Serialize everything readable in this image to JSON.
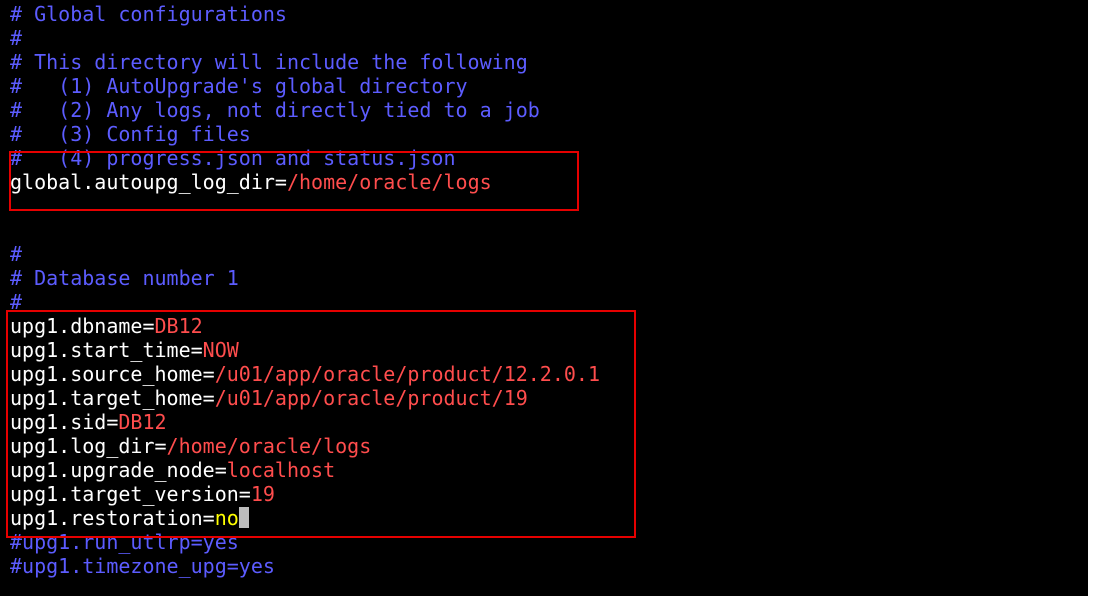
{
  "editor": {
    "comments_top": [
      "# Global configurations",
      "#",
      "# This directory will include the following",
      "#   (1) AutoUpgrade's global directory",
      "#   (2) Any logs, not directly tied to a job",
      "#   (3) Config files",
      "#   (4) progress.json and status.json"
    ],
    "global_log_dir": {
      "key": "global.autoupg_log_dir=",
      "value": "/home/oracle/logs"
    },
    "blank_1": "",
    "blank_2": "",
    "comments_db": [
      "#",
      "# Database number 1",
      "#"
    ],
    "db_params": [
      {
        "key": "upg1.dbname=",
        "value": "DB12"
      },
      {
        "key": "upg1.start_time=",
        "value": "NOW"
      },
      {
        "key": "upg1.source_home=",
        "value": "/u01/app/oracle/product/12.2.0.1"
      },
      {
        "key": "upg1.target_home=",
        "value": "/u01/app/oracle/product/19"
      },
      {
        "key": "upg1.sid=",
        "value": "DB12"
      },
      {
        "key": "upg1.log_dir=",
        "value": "/home/oracle/logs"
      },
      {
        "key": "upg1.upgrade_node=",
        "value": "localhost"
      },
      {
        "key": "upg1.target_version=",
        "value": "19"
      },
      {
        "key": "upg1.restoration=",
        "value": "no"
      }
    ],
    "comments_bottom": [
      "#upg1.run_utlrp=yes",
      "#upg1.timezone_upg=yes"
    ]
  },
  "colors": {
    "background": "#000000",
    "comment": "#5c5cff",
    "key": "#ffffff",
    "value": "#ff4d4d",
    "value_under_cursor": "#ffff00",
    "cursor": "#bdbdbd",
    "annotation_box": "#e60000"
  }
}
